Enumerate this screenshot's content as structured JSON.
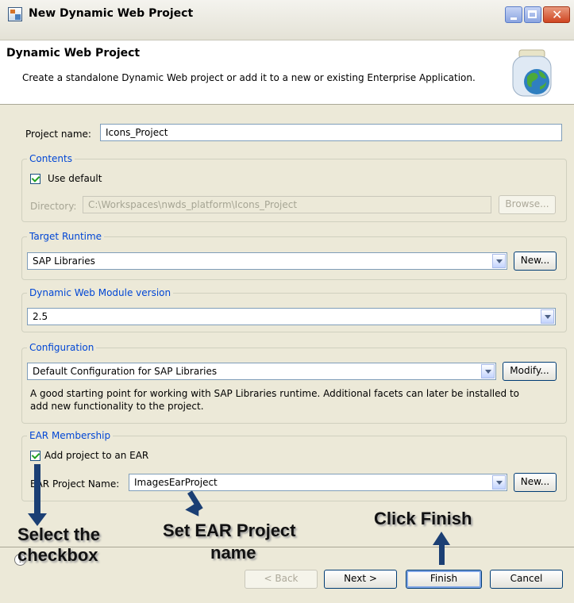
{
  "window": {
    "title": "New Dynamic Web Project",
    "controls": {
      "minimize": "minimize",
      "maximize": "maximize",
      "close": "close"
    }
  },
  "banner": {
    "title": "Dynamic Web Project",
    "description": "Create a standalone Dynamic Web project or add it to a new or existing Enterprise Application.",
    "icon": "jar-globe-icon"
  },
  "project": {
    "label": "Project name:",
    "value": "Icons_Project"
  },
  "contents": {
    "legend": "Contents",
    "use_default": {
      "label": "Use default",
      "checked": true
    },
    "directory_label": "Directory:",
    "directory_value": "C:\\Workspaces\\nwds_platform\\Icons_Project",
    "browse_label": "Browse..."
  },
  "target_runtime": {
    "legend": "Target Runtime",
    "value": "SAP Libraries",
    "new_label": "New..."
  },
  "module_version": {
    "legend": "Dynamic Web Module version",
    "value": "2.5"
  },
  "configuration": {
    "legend": "Configuration",
    "value": "Default Configuration for SAP Libraries",
    "modify_label": "Modify...",
    "description_line1": "A good starting point for working with SAP Libraries runtime. Additional facets can later be installed to",
    "description_line2": "add new functionality to the project."
  },
  "ear": {
    "legend": "EAR Membership",
    "add_label": "Add project to an EAR",
    "add_checked": true,
    "name_label": "EAR Project Name:",
    "name_value": "ImagesEarProject",
    "new_label": "New..."
  },
  "footer": {
    "help": "?",
    "back_label": "< Back",
    "next_label": "Next >",
    "finish_label": "Finish",
    "cancel_label": "Cancel"
  },
  "annotations": {
    "select_line1": "Select the",
    "select_line2": "checkbox",
    "set_line1": "Set EAR Project",
    "set_line2": "name",
    "finish": "Click Finish"
  },
  "colors": {
    "group_label": "#0046d5",
    "arrow": "#1b3f74",
    "dialog_bg": "#ece9d8"
  }
}
